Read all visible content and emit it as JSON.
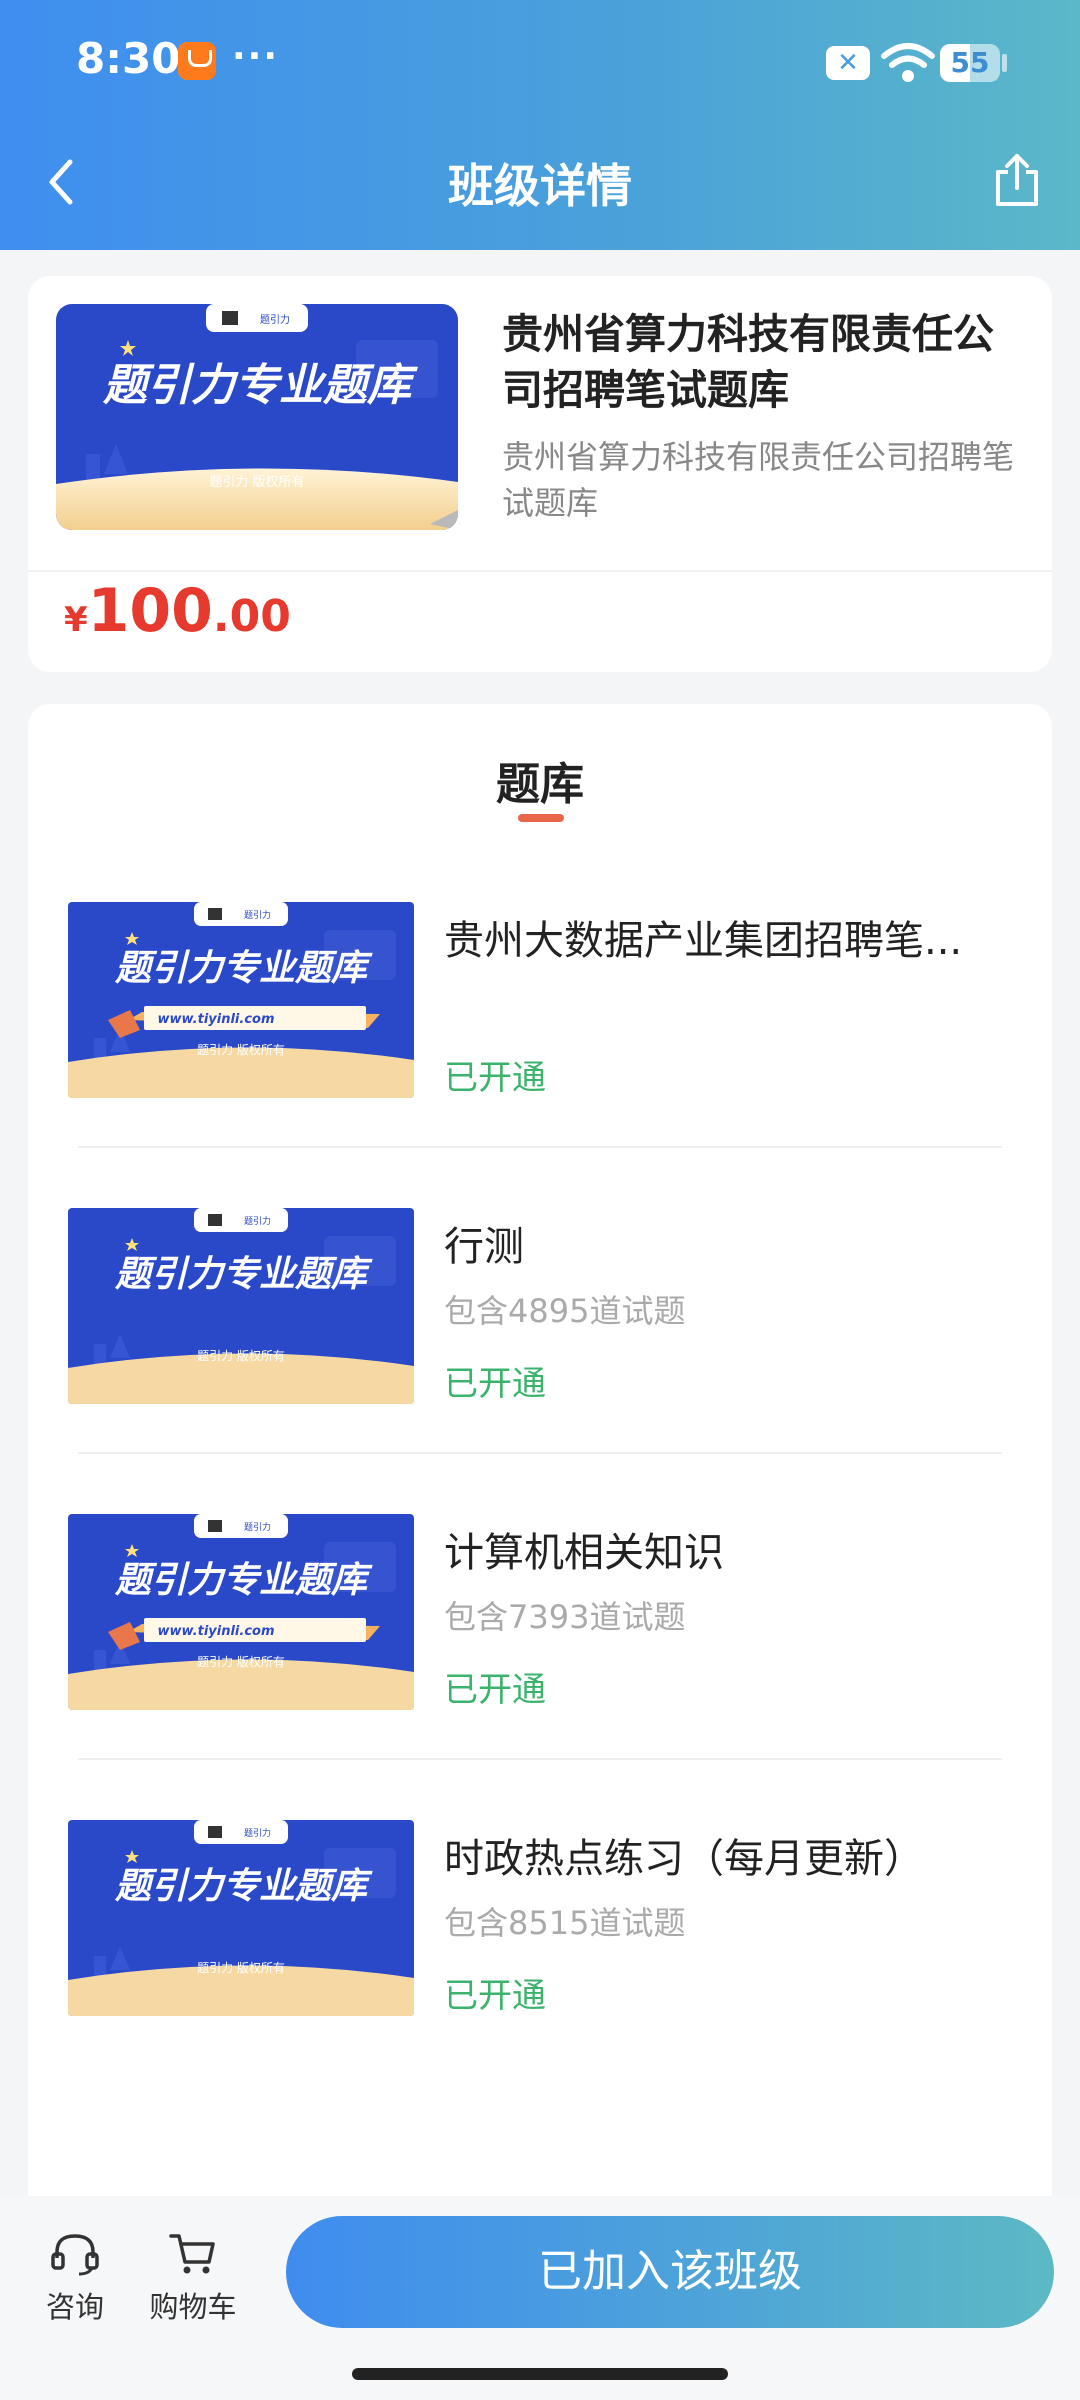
{
  "status_bar": {
    "time": "8:30",
    "dots": "···",
    "battery": "55"
  },
  "nav": {
    "title": "班级详情"
  },
  "class_info": {
    "title": "贵州省算力科技有限责任公司招聘笔试题库",
    "subtitle": "贵州省算力科技有限责任公司招聘笔试题库",
    "price_currency": "¥",
    "price_int": "100",
    "price_dec": ".00",
    "thumb": {
      "brand": "题引力",
      "headline": "题引力专业题库",
      "footer": "题引力 版权所有",
      "url": "www.tiyinli.com"
    }
  },
  "bank_section": {
    "tab_label": "题库",
    "items": [
      {
        "name": "贵州大数据产业集团招聘笔...",
        "count": "",
        "status": "已开通",
        "show_url": true
      },
      {
        "name": "行测",
        "count": "包含4895道试题",
        "status": "已开通",
        "show_url": false
      },
      {
        "name": "计算机相关知识",
        "count": "包含7393道试题",
        "status": "已开通",
        "show_url": true
      },
      {
        "name": "时政热点练习（每月更新）",
        "count": "包含8515道试题",
        "status": "已开通",
        "show_url": false
      }
    ]
  },
  "bottom_bar": {
    "consult_label": "咨询",
    "cart_label": "购物车",
    "join_label": "已加入该班级"
  },
  "colors": {
    "accent_blue": "#3f8ef0",
    "price_red": "#e53a2d",
    "status_green": "#3bb36c",
    "tab_underline": "#e8654a"
  }
}
